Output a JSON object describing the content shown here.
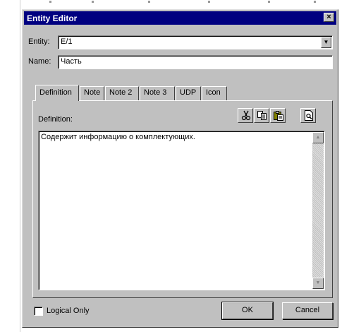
{
  "dialog": {
    "title": "Entity Editor",
    "close_glyph": "×"
  },
  "entity": {
    "label": "Entity:",
    "value": "E/1"
  },
  "name": {
    "label": "Name:",
    "value": "Часть"
  },
  "tabs": [
    {
      "label": "Definition"
    },
    {
      "label": "Note"
    },
    {
      "label": "Note 2"
    },
    {
      "label": "Note 3"
    },
    {
      "label": "UDP"
    },
    {
      "label": "Icon"
    }
  ],
  "definition": {
    "label": "Definition:",
    "text": "Содержит информацию о комплектующих."
  },
  "toolbar": {
    "icons": [
      "cut-icon",
      "copy-icon",
      "paste-icon",
      "preview-icon"
    ]
  },
  "footer": {
    "logical_only_label": "Logical Only",
    "ok_label": "OK",
    "cancel_label": "Cancel"
  }
}
